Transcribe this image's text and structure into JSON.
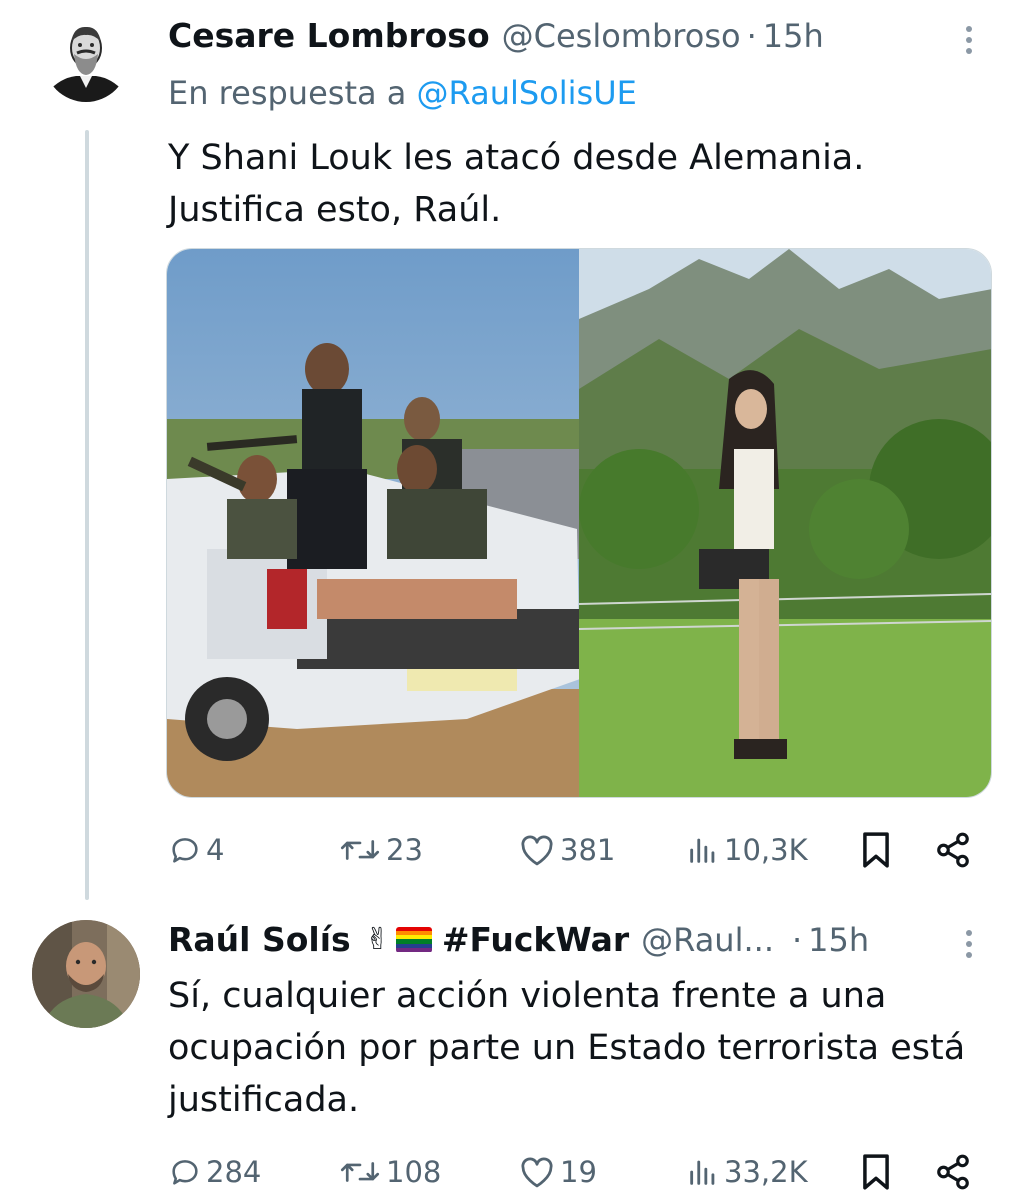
{
  "tweet1": {
    "author_name": "Cesare Lombroso",
    "handle": "@Ceslombroso",
    "separator": "·",
    "time": "15h",
    "reply_prefix": "En respuesta a",
    "reply_mention": "@RaulSolisUE",
    "text_line1": "Y Shani Louk les atacó desde Alemania.",
    "text_line2": "Justifica esto, Raúl.",
    "stats": {
      "replies": "4",
      "retweets": "23",
      "likes": "381",
      "views": "10,3K"
    }
  },
  "tweet2": {
    "author_name": "Raúl Solís",
    "emoji": "✌",
    "hashtag": "#FuckWar",
    "handle": "@Raul...",
    "separator": "·",
    "time": "15h",
    "text_line1": "Sí, cualquier acción violenta frente a una",
    "text_line2": "ocupación por parte un Estado terrorista está",
    "text_line3": "justificada.",
    "stats": {
      "replies": "284",
      "retweets": "108",
      "likes": "19",
      "views": "33,2K"
    }
  },
  "icons": {
    "reply": "reply-icon",
    "retweet": "retweet-icon",
    "like": "heart-icon",
    "views": "views-icon",
    "bookmark": "bookmark-icon",
    "share": "share-icon"
  },
  "colors": {
    "text": "#0f1419",
    "secondary": "#536471",
    "link": "#1d9bf0",
    "thread_line": "#cfd9de"
  }
}
